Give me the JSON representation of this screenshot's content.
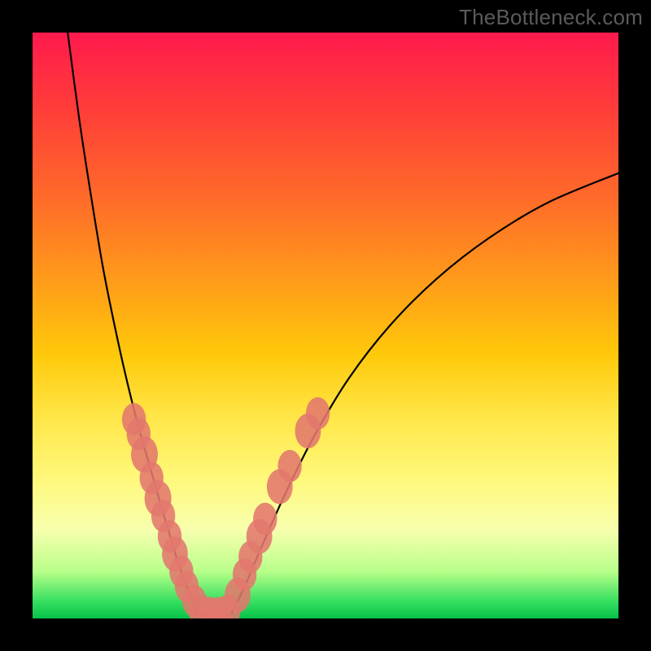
{
  "watermark": "TheBottleneck.com",
  "chart_data": {
    "type": "line",
    "title": "",
    "xlabel": "",
    "ylabel": "",
    "xlim": [
      0,
      100
    ],
    "ylim": [
      0,
      100
    ],
    "legend": false,
    "grid": false,
    "background_gradient": {
      "orientation": "vertical",
      "stops": [
        {
          "pos": 0.0,
          "color": "#ff1a4d"
        },
        {
          "pos": 0.55,
          "color": "#ffc90a"
        },
        {
          "pos": 0.85,
          "color": "#f7ffae"
        },
        {
          "pos": 1.0,
          "color": "#07c24a"
        }
      ]
    },
    "series": [
      {
        "name": "left-branch",
        "color": "#000000",
        "x": [
          6,
          8,
          10,
          12,
          14,
          16,
          18,
          20,
          22,
          23.5,
          25,
          26.5,
          28
        ],
        "y": [
          100,
          85,
          72,
          60,
          50,
          41,
          33,
          26,
          19,
          14,
          9,
          5,
          1
        ]
      },
      {
        "name": "valley",
        "color": "#000000",
        "x": [
          28,
          29,
          30,
          31,
          32,
          33,
          34
        ],
        "y": [
          1,
          0.5,
          0.3,
          0.2,
          0.3,
          0.5,
          1
        ]
      },
      {
        "name": "right-branch",
        "color": "#000000",
        "x": [
          34,
          36,
          39,
          43,
          48,
          54,
          61,
          69,
          78,
          88,
          100
        ],
        "y": [
          1,
          5,
          12,
          21,
          31,
          41,
          50,
          58,
          65,
          71,
          76
        ]
      }
    ],
    "marker_clusters": [
      {
        "name": "left-cluster",
        "color": "#e2776d",
        "points": [
          {
            "x": 17.3,
            "y": 34.0,
            "r": 2.4
          },
          {
            "x": 18.1,
            "y": 31.5,
            "r": 2.4
          },
          {
            "x": 19.1,
            "y": 28.0,
            "r": 2.7
          },
          {
            "x": 20.3,
            "y": 24.0,
            "r": 2.4
          },
          {
            "x": 21.4,
            "y": 20.5,
            "r": 2.7
          },
          {
            "x": 22.3,
            "y": 17.5,
            "r": 2.4
          },
          {
            "x": 23.4,
            "y": 14.0,
            "r": 2.4
          },
          {
            "x": 24.3,
            "y": 11.0,
            "r": 2.6
          },
          {
            "x": 25.4,
            "y": 8.0,
            "r": 2.4
          },
          {
            "x": 26.3,
            "y": 5.5,
            "r": 2.4
          },
          {
            "x": 27.6,
            "y": 3.0,
            "r": 2.4
          }
        ]
      },
      {
        "name": "bottom-cluster",
        "color": "#e2776d",
        "points": [
          {
            "x": 28.8,
            "y": 1.2,
            "r": 2.5
          },
          {
            "x": 30.3,
            "y": 0.8,
            "r": 2.5
          },
          {
            "x": 31.8,
            "y": 0.8,
            "r": 2.5
          },
          {
            "x": 33.3,
            "y": 1.2,
            "r": 2.5
          }
        ]
      },
      {
        "name": "right-cluster",
        "color": "#e2776d",
        "points": [
          {
            "x": 35.0,
            "y": 4.0,
            "r": 2.6
          },
          {
            "x": 36.2,
            "y": 7.5,
            "r": 2.4
          },
          {
            "x": 37.2,
            "y": 10.5,
            "r": 2.4
          },
          {
            "x": 38.7,
            "y": 14.0,
            "r": 2.6
          },
          {
            "x": 39.7,
            "y": 17.0,
            "r": 2.4
          },
          {
            "x": 42.2,
            "y": 22.5,
            "r": 2.6
          },
          {
            "x": 43.9,
            "y": 26.0,
            "r": 2.4
          },
          {
            "x": 47.0,
            "y": 32.0,
            "r": 2.6
          },
          {
            "x": 48.7,
            "y": 35.0,
            "r": 2.4
          }
        ]
      }
    ]
  }
}
